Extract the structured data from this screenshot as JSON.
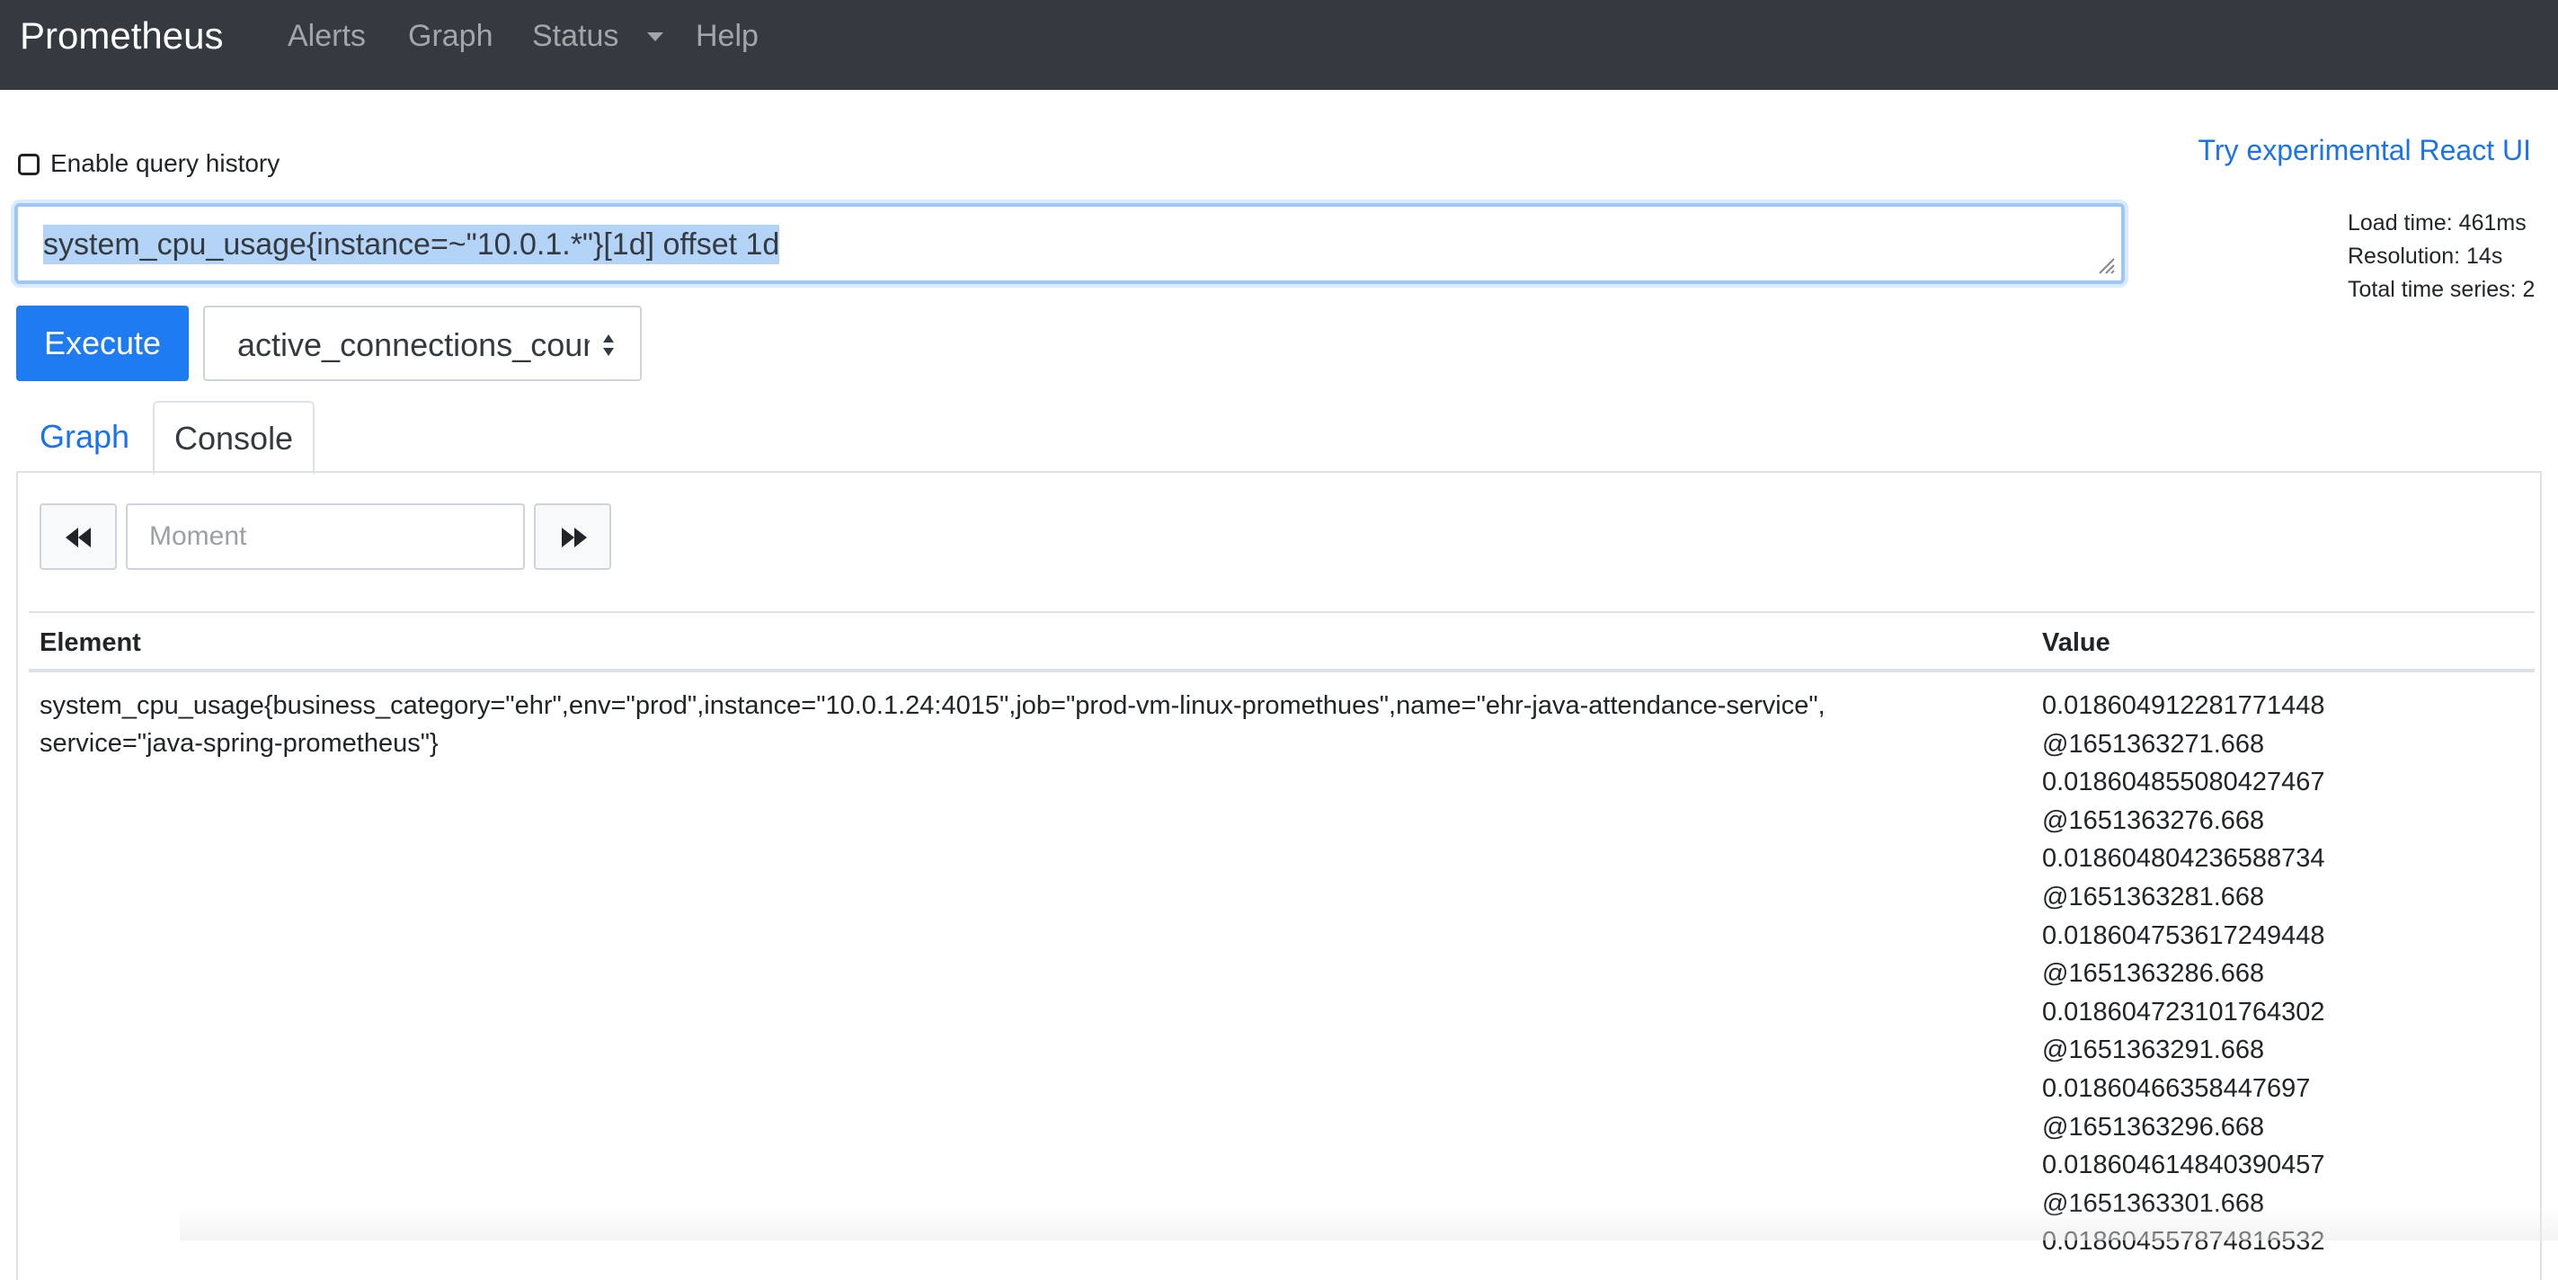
{
  "navbar": {
    "brand": "Prometheus",
    "links": {
      "alerts": "Alerts",
      "graph": "Graph",
      "status": "Status",
      "help": "Help"
    }
  },
  "query_history": {
    "label": "Enable query history",
    "checked": false
  },
  "react_ui_link": "Try experimental React UI",
  "expression": {
    "value": "system_cpu_usage{instance=~\"10.0.1.*\"}[1d] offset 1d",
    "selected": true
  },
  "stats": {
    "load_time": "Load time: 461ms",
    "resolution": "Resolution: 14s",
    "total_series": "Total time series: 2"
  },
  "execute_label": "Execute",
  "metric_select": {
    "selected": "active_connections_count"
  },
  "tabs": {
    "graph": "Graph",
    "console": "Console",
    "active": "console"
  },
  "moment": {
    "placeholder": "Moment"
  },
  "table": {
    "headers": {
      "element": "Element",
      "value": "Value"
    },
    "rows": [
      {
        "element": "system_cpu_usage{business_category=\"ehr\",env=\"prod\",instance=\"10.0.1.24:4015\",job=\"prod-vm-linux-promethues\",name=\"ehr-java-attendance-service\",service=\"java-spring-prometheus\"}",
        "values": [
          "0.018604912281771448",
          "@1651363271.668",
          "0.018604855080427467",
          "@1651363276.668",
          "0.018604804236588734",
          "@1651363281.668",
          "0.018604753617249448",
          "@1651363286.668",
          "0.018604723101764302",
          "@1651363291.668",
          "0.01860466358447697",
          "@1651363296.668",
          "0.018604614840390457",
          "@1651363301.668",
          "0.018604557874816532"
        ]
      }
    ]
  },
  "colors": {
    "navbar_bg": "#343a40",
    "primary": "#1e7bf2",
    "link": "#1a73e8",
    "selection": "#b4d4f7"
  }
}
